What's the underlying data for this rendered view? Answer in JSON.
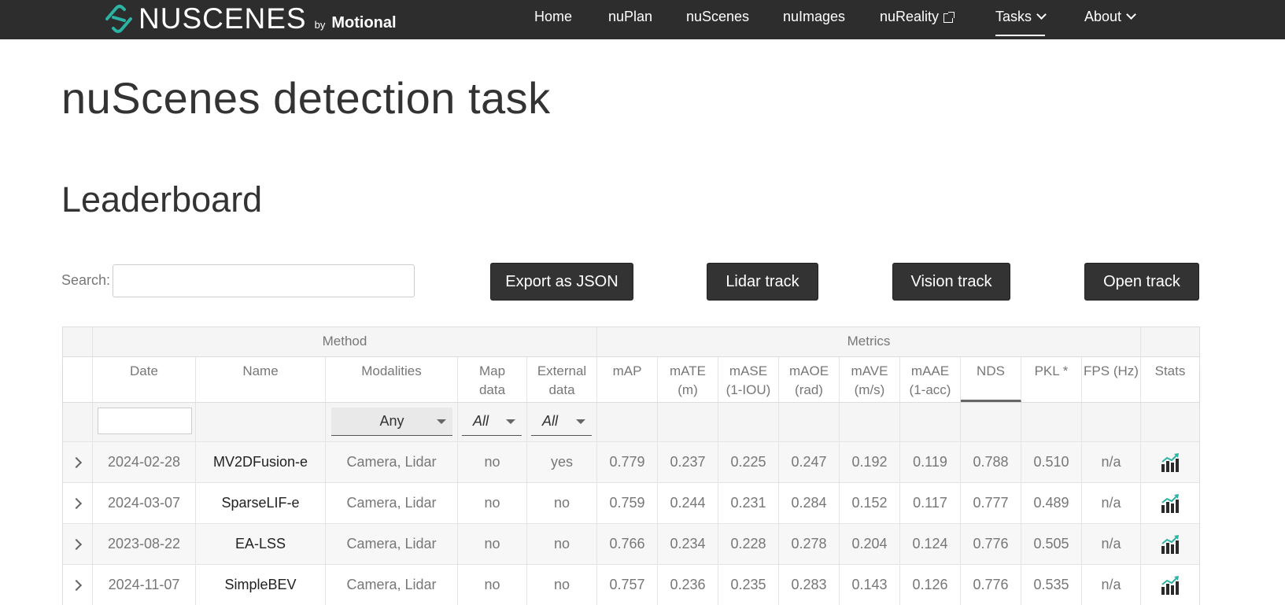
{
  "nav": {
    "logo_text": "NUSCENES",
    "logo_by": "by",
    "logo_brand": "Motional",
    "items": [
      {
        "label": "Home"
      },
      {
        "label": "nuPlan"
      },
      {
        "label": "nuScenes"
      },
      {
        "label": "nuImages"
      },
      {
        "label": "nuReality"
      },
      {
        "label": "Tasks"
      },
      {
        "label": "About"
      }
    ]
  },
  "page": {
    "title": "nuScenes detection task",
    "section": "Leaderboard"
  },
  "search": {
    "label": "Search:",
    "placeholder": "",
    "value": ""
  },
  "buttons": {
    "export": "Export as JSON",
    "lidar": "Lidar track",
    "vision": "Vision track",
    "open": "Open track"
  },
  "table": {
    "groups": {
      "method": "Method",
      "metrics": "Metrics"
    },
    "headers": {
      "date": "Date",
      "name": "Name",
      "modalities": "Modalities",
      "map_data_1": "Map",
      "map_data_2": "data",
      "external_1": "External",
      "external_2": "data",
      "map": "mAP",
      "mate_1": "mATE",
      "mate_2": "(m)",
      "mase_1": "mASE",
      "mase_2": "(1-IOU)",
      "maoe_1": "mAOE",
      "maoe_2": "(rad)",
      "mave_1": "mAVE",
      "mave_2": "(m/s)",
      "maae_1": "mAAE",
      "maae_2": "(1-acc)",
      "nds": "NDS",
      "pkl": "PKL *",
      "fps": "FPS (Hz)",
      "stats": "Stats"
    },
    "filters": {
      "modalities": "Any",
      "map_data": "All",
      "external": "All"
    },
    "rows": [
      {
        "date": "2024-02-28",
        "name": "MV2DFusion-e",
        "modalities": "Camera, Lidar",
        "map_data": "no",
        "external": "yes",
        "map": "0.779",
        "mate": "0.237",
        "mase": "0.225",
        "maoe": "0.247",
        "mave": "0.192",
        "maae": "0.119",
        "nds": "0.788",
        "pkl": "0.510",
        "fps": "n/a"
      },
      {
        "date": "2024-03-07",
        "name": "SparseLIF-e",
        "modalities": "Camera, Lidar",
        "map_data": "no",
        "external": "no",
        "map": "0.759",
        "mate": "0.244",
        "mase": "0.231",
        "maoe": "0.284",
        "mave": "0.152",
        "maae": "0.117",
        "nds": "0.777",
        "pkl": "0.489",
        "fps": "n/a"
      },
      {
        "date": "2023-08-22",
        "name": "EA-LSS",
        "modalities": "Camera, Lidar",
        "map_data": "no",
        "external": "no",
        "map": "0.766",
        "mate": "0.234",
        "mase": "0.228",
        "maoe": "0.278",
        "mave": "0.204",
        "maae": "0.124",
        "nds": "0.776",
        "pkl": "0.505",
        "fps": "n/a"
      },
      {
        "date": "2024-11-07",
        "name": "SimpleBEV",
        "modalities": "Camera, Lidar",
        "map_data": "no",
        "external": "no",
        "map": "0.757",
        "mate": "0.236",
        "mase": "0.235",
        "maoe": "0.283",
        "mave": "0.143",
        "maae": "0.126",
        "nds": "0.776",
        "pkl": "0.535",
        "fps": "n/a"
      }
    ]
  },
  "colors": {
    "navbar": "#2d2d2d",
    "button": "#333333",
    "accent_teal": "#2bb3a3"
  }
}
